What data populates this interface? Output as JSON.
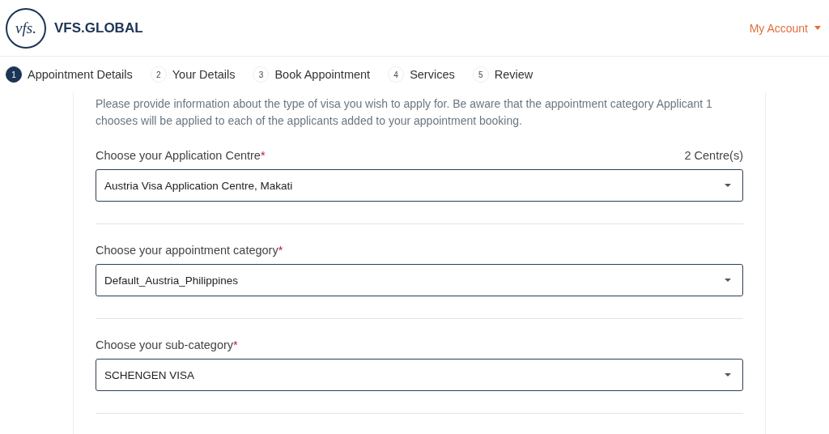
{
  "header": {
    "logo_mark": "vfs.",
    "brand": "VFS.GLOBAL",
    "account_menu": "My Account"
  },
  "steps": [
    {
      "number": "1",
      "label": "Appointment Details",
      "selected": true
    },
    {
      "number": "2",
      "label": "Your Details",
      "selected": false
    },
    {
      "number": "3",
      "label": "Book Appointment",
      "selected": false
    },
    {
      "number": "4",
      "label": "Services",
      "selected": false
    },
    {
      "number": "5",
      "label": "Review",
      "selected": false
    }
  ],
  "intro": "Please provide information about the type of visa you wish to apply for. Be aware that the appointment category Applicant 1 chooses will be applied to each of the applicants added to your appointment booking.",
  "fields": [
    {
      "label": "Choose your Application Centre",
      "required_mark": "*",
      "count": "2 Centre(s)",
      "value": "Austria Visa Application Centre, Makati"
    },
    {
      "label": "Choose your appointment category",
      "required_mark": "*",
      "value": "Default_Austria_Philippines"
    },
    {
      "label": "Choose your sub-category",
      "required_mark": "*",
      "value": "SCHENGEN VISA"
    }
  ]
}
